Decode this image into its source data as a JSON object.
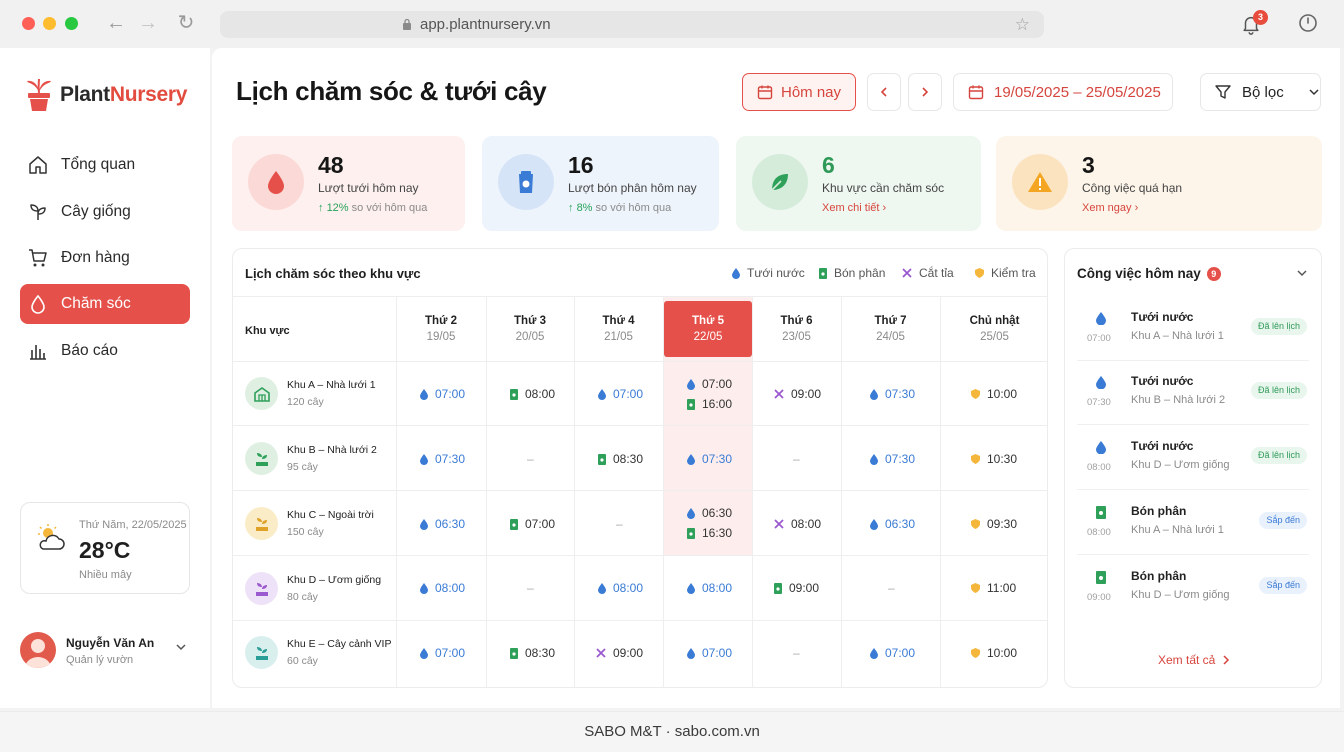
{
  "browser": {
    "url": "app.plantnursery.vn",
    "notif_count": "3"
  },
  "brand": {
    "part1": "Plant",
    "part2": "Nursery"
  },
  "sidebar": {
    "items": [
      {
        "label": "Tổng quan",
        "icon": "home-icon"
      },
      {
        "label": "Cây giống",
        "icon": "seedling-icon"
      },
      {
        "label": "Đơn hàng",
        "icon": "cart-icon"
      },
      {
        "label": "Chăm sóc",
        "icon": "droplet-icon",
        "active": true
      },
      {
        "label": "Báo cáo",
        "icon": "bar-chart-icon"
      }
    ],
    "weather": {
      "date": "Thứ Năm, 22/05/2025",
      "temp": "28°C",
      "desc": "Nhiều mây"
    },
    "user": {
      "name": "Nguyễn Văn An",
      "role": "Quản lý vườn"
    }
  },
  "header": {
    "title": "Lịch chăm sóc & tưới cây",
    "today_label": "Hôm nay",
    "date_range": "19/05/2025 – 25/05/2025",
    "filter_label": "Bộ lọc"
  },
  "stats": [
    {
      "value": "48",
      "label": "Lượt tưới hôm nay",
      "trend": "12%",
      "trend_text": "so với hôm qua"
    },
    {
      "value": "16",
      "label": "Lượt bón phân hôm nay",
      "trend": "8%",
      "trend_text": "so với hôm qua"
    },
    {
      "value": "6",
      "label": "Khu vực cần chăm sóc",
      "link": "Xem chi tiết"
    },
    {
      "value": "3",
      "label": "Công việc quá hạn",
      "link": "Xem ngay"
    }
  ],
  "schedule": {
    "title": "Lịch chăm sóc theo khu vực",
    "legend": [
      "Tưới nước",
      "Bón phân",
      "Cắt tỉa",
      "Kiểm tra"
    ],
    "zone_header": "Khu vực",
    "days": [
      {
        "name": "Thứ 2",
        "date": "19/05"
      },
      {
        "name": "Thứ 3",
        "date": "20/05"
      },
      {
        "name": "Thứ 4",
        "date": "21/05"
      },
      {
        "name": "Thứ 5",
        "date": "22/05"
      },
      {
        "name": "Thứ 6",
        "date": "23/05"
      },
      {
        "name": "Thứ 7",
        "date": "24/05"
      },
      {
        "name": "Chủ nhật",
        "date": "25/05"
      }
    ],
    "zones": [
      {
        "name": "Khu A – Nhà lưới 1",
        "count": "120 cây"
      },
      {
        "name": "Khu B – Nhà lưới 2",
        "count": "95 cây"
      },
      {
        "name": "Khu C – Ngoài trời",
        "count": "150 cây"
      },
      {
        "name": "Khu D – Ươm giống",
        "count": "80 cây"
      },
      {
        "name": "Khu E – Cây cảnh VIP",
        "count": "60 cây"
      }
    ],
    "rows": [
      [
        "07:00",
        "08:00",
        "07:00",
        "07:00",
        "16:00",
        "09:00",
        "07:30",
        "10:00"
      ],
      [
        "07:30",
        "–",
        "08:30",
        "07:30",
        "–",
        "07:30",
        "10:30"
      ],
      [
        "06:30",
        "07:00",
        "–",
        "06:30",
        "16:30",
        "08:00",
        "06:30",
        "09:30"
      ],
      [
        "08:00",
        "–",
        "08:00",
        "08:00",
        "09:00",
        "–",
        "11:00"
      ],
      [
        "07:00",
        "08:30",
        "09:00",
        "07:00",
        "–",
        "07:00",
        "10:00"
      ]
    ]
  },
  "tasks": {
    "title": "Công việc hôm nay",
    "count": "9",
    "items": [
      {
        "name": "Tưới nước",
        "location": "Khu A – Nhà lưới 1",
        "time": "07:00",
        "status": "Đã lên lịch"
      },
      {
        "name": "Tưới nước",
        "location": "Khu B – Nhà lưới 2",
        "time": "07:30",
        "status": "Đã lên lịch"
      },
      {
        "name": "Tưới nước",
        "location": "Khu D – Ươm giống",
        "time": "08:00",
        "status": "Đã lên lịch"
      },
      {
        "name": "Bón phân",
        "location": "Khu A – Nhà lưới 1",
        "time": "08:00",
        "status": "Sắp đến"
      },
      {
        "name": "Bón phân",
        "location": "Khu D – Ươm giống",
        "time": "09:00",
        "status": "Sắp đến"
      }
    ],
    "see_all": "Xem tất cả"
  },
  "footer": {
    "text": "SABO M&T · sabo.com.vn"
  }
}
